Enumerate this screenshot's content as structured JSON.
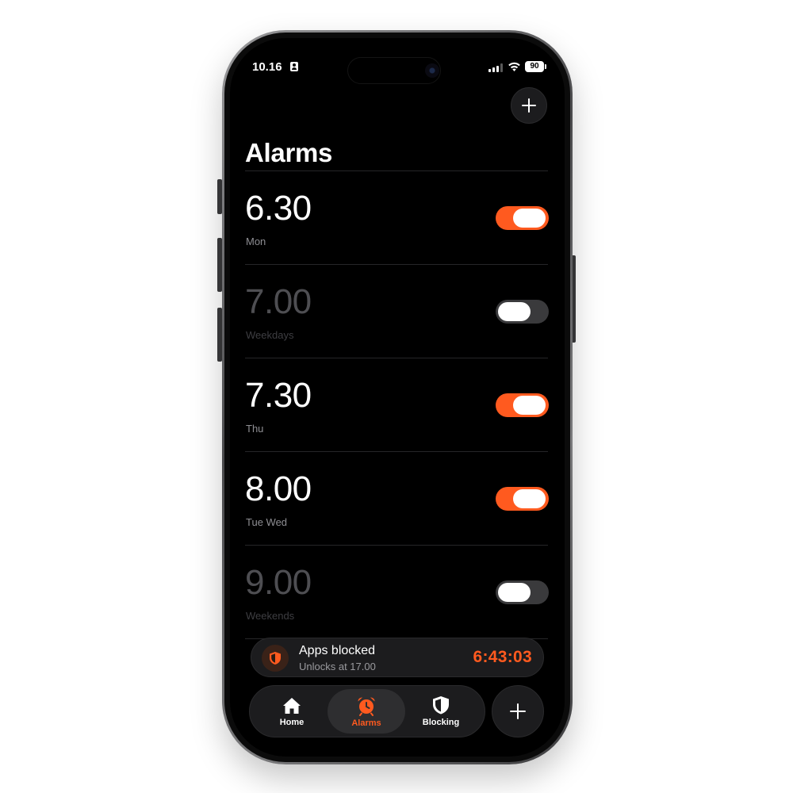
{
  "colors": {
    "accent": "#ff5a1f",
    "toggle_on": "#ff5a1f",
    "toggle_off": "#3a3a3c",
    "background": "#000000",
    "card": "#1c1c1e"
  },
  "status_bar": {
    "time": "10.16",
    "battery": "90"
  },
  "header": {
    "title": "Alarms",
    "add_icon": "plus-icon"
  },
  "alarms": [
    {
      "time": "6.30",
      "days": "Mon",
      "enabled": true
    },
    {
      "time": "7.00",
      "days": "Weekdays",
      "enabled": false
    },
    {
      "time": "7.30",
      "days": "Thu",
      "enabled": true
    },
    {
      "time": "8.00",
      "days": "Tue Wed",
      "enabled": true
    },
    {
      "time": "9.00",
      "days": "Weekends",
      "enabled": false
    }
  ],
  "block_banner": {
    "icon": "shield-icon",
    "title": "Apps blocked",
    "subtitle": "Unlocks at 17.00",
    "timer": "6:43:03"
  },
  "tab_bar": {
    "tabs": [
      {
        "label": "Home",
        "icon": "house-icon",
        "active": false
      },
      {
        "label": "Alarms",
        "icon": "alarm-clock-icon",
        "active": true
      },
      {
        "label": "Blocking",
        "icon": "shield-icon",
        "active": false
      }
    ],
    "fab_icon": "plus-icon"
  }
}
